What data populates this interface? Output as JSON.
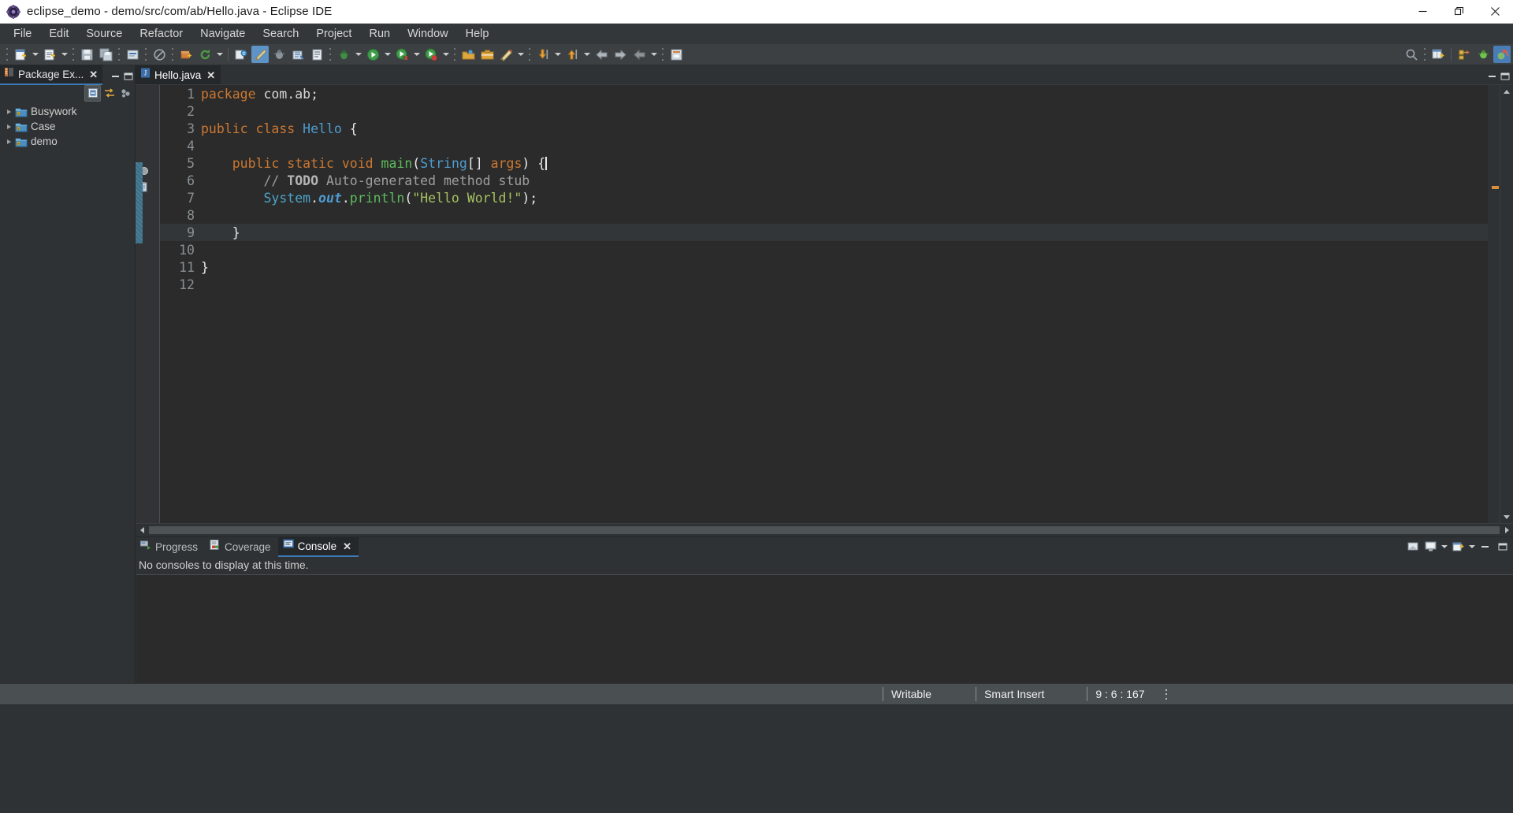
{
  "window": {
    "title": "eclipse_demo - demo/src/com/ab/Hello.java - Eclipse IDE",
    "app_icon": "eclipse-icon",
    "controls": {
      "minimize": "minimize-icon",
      "restore": "restore-icon",
      "close": "close-icon"
    }
  },
  "menubar": {
    "items": [
      {
        "label": "File"
      },
      {
        "label": "Edit"
      },
      {
        "label": "Source"
      },
      {
        "label": "Refactor"
      },
      {
        "label": "Navigate"
      },
      {
        "label": "Search"
      },
      {
        "label": "Project"
      },
      {
        "label": "Run"
      },
      {
        "label": "Window"
      },
      {
        "label": "Help"
      }
    ]
  },
  "toolbar": {
    "groups": [
      {
        "items": [
          {
            "icon": "new-wizard-icon",
            "dropdown": true
          },
          {
            "icon": "new-java-project-icon",
            "dropdown": true
          }
        ]
      },
      {
        "items": [
          {
            "icon": "save-icon",
            "dropdown": false
          },
          {
            "icon": "save-all-icon",
            "dropdown": false
          }
        ]
      },
      {
        "items": [
          {
            "icon": "print-icon",
            "dropdown": false
          }
        ]
      },
      {
        "items": [
          {
            "icon": "no-entry-icon",
            "dropdown": false
          }
        ]
      },
      {
        "items": [
          {
            "icon": "new-package-icon",
            "dropdown": false
          },
          {
            "icon": "refresh-icon",
            "dropdown": true
          }
        ]
      },
      {
        "items": [
          {
            "icon": "open-type-icon",
            "dropdown": false
          },
          {
            "icon": "search-ruler-icon",
            "dropdown": false
          },
          {
            "icon": "debug-bug-icon",
            "dropdown": false
          },
          {
            "icon": "external-tools-icon",
            "dropdown": false
          },
          {
            "icon": "open-task-icon",
            "dropdown": false
          }
        ]
      },
      {
        "items": [
          {
            "icon": "debug-icon",
            "dropdown": true
          }
        ]
      },
      {
        "items": [
          {
            "icon": "run-icon",
            "dropdown": true
          },
          {
            "icon": "coverage-icon",
            "dropdown": true
          },
          {
            "icon": "run-record-icon",
            "dropdown": true
          }
        ]
      },
      {
        "items": [
          {
            "icon": "open-folder-icon",
            "dropdown": false
          },
          {
            "icon": "briefcase-icon",
            "dropdown": false
          },
          {
            "icon": "pencil-icon",
            "dropdown": true
          }
        ]
      },
      {
        "items": [
          {
            "icon": "step-into-icon",
            "dropdown": true
          },
          {
            "icon": "step-return-icon",
            "dropdown": true
          }
        ]
      },
      {
        "items": [
          {
            "icon": "back-arrow-icon",
            "dropdown": false
          },
          {
            "icon": "forward-arrow-icon",
            "dropdown": false
          },
          {
            "icon": "previous-arrow-icon",
            "dropdown": false
          },
          {
            "icon": "next-arrow-icon",
            "dropdown": false
          }
        ]
      },
      {
        "items": [
          {
            "icon": "pin-editor-icon",
            "dropdown": false
          }
        ]
      }
    ],
    "right": [
      {
        "icon": "quick-search-icon"
      },
      {
        "icon": "new-window-icon"
      },
      {
        "icon": "java-perspective-icon"
      },
      {
        "icon": "debug-perspective-icon"
      },
      {
        "icon": "java-ee-perspective-icon"
      }
    ]
  },
  "package_explorer": {
    "tab_label": "Package Ex...",
    "tab_icon": "package-explorer-icon",
    "close_icon": "close-icon",
    "minimize_icon": "minimize-icon",
    "maximize_icon": "maximize-icon",
    "view_toolbar": [
      {
        "icon": "collapse-all-icon",
        "selected": true
      },
      {
        "icon": "link-with-editor-icon",
        "selected": false
      },
      {
        "icon": "view-menu-icon",
        "selected": false
      }
    ],
    "tree": [
      {
        "label": "Busywork",
        "icon": "java-project-icon",
        "expanded": false
      },
      {
        "label": "Case",
        "icon": "java-project-icon",
        "expanded": false
      },
      {
        "label": "demo",
        "icon": "java-project-icon",
        "expanded": false
      }
    ]
  },
  "editor": {
    "tab": {
      "label": "Hello.java",
      "icon": "java-file-icon",
      "close_icon": "close-icon"
    },
    "minimize_icon": "minimize-icon",
    "maximize_icon": "maximize-icon",
    "lines": [
      {
        "n": "1",
        "tokens": [
          {
            "t": "package",
            "c": "kw"
          },
          {
            "t": " com.ab;",
            "c": "ctext"
          }
        ]
      },
      {
        "n": "2",
        "tokens": []
      },
      {
        "n": "3",
        "tokens": [
          {
            "t": "public",
            "c": "kw"
          },
          {
            "t": " ",
            "c": "ctext"
          },
          {
            "t": "class",
            "c": "kw"
          },
          {
            "t": " ",
            "c": "ctext"
          },
          {
            "t": "Hello",
            "c": "cls"
          },
          {
            "t": " {",
            "c": "punct"
          }
        ]
      },
      {
        "n": "4",
        "tokens": []
      },
      {
        "n": "5",
        "tokens": [
          {
            "t": "    ",
            "c": "ctext"
          },
          {
            "t": "public",
            "c": "kw"
          },
          {
            "t": " ",
            "c": "ctext"
          },
          {
            "t": "static",
            "c": "kw"
          },
          {
            "t": " ",
            "c": "ctext"
          },
          {
            "t": "void",
            "c": "kw"
          },
          {
            "t": " ",
            "c": "ctext"
          },
          {
            "t": "main",
            "c": "mth"
          },
          {
            "t": "(",
            "c": "punct"
          },
          {
            "t": "String",
            "c": "cls"
          },
          {
            "t": "[] ",
            "c": "punct"
          },
          {
            "t": "args",
            "c": "kw"
          },
          {
            "t": ") {",
            "c": "punct"
          }
        ]
      },
      {
        "n": "6",
        "tokens": [
          {
            "t": "        // ",
            "c": "cmt"
          },
          {
            "t": "TODO",
            "c": "cmtb"
          },
          {
            "t": " Auto-generated method stub",
            "c": "cmt"
          }
        ]
      },
      {
        "n": "7",
        "tokens": [
          {
            "t": "        ",
            "c": "ctext"
          },
          {
            "t": "System",
            "c": "fld"
          },
          {
            "t": ".",
            "c": "punct"
          },
          {
            "t": "out",
            "c": "fldi"
          },
          {
            "t": ".",
            "c": "punct"
          },
          {
            "t": "println",
            "c": "mth"
          },
          {
            "t": "(",
            "c": "punct"
          },
          {
            "t": "\"Hello World!\"",
            "c": "str"
          },
          {
            "t": ");",
            "c": "punct"
          }
        ]
      },
      {
        "n": "8",
        "tokens": []
      },
      {
        "n": "9",
        "tokens": [
          {
            "t": "    }",
            "c": "punct"
          }
        ],
        "highlight": true
      },
      {
        "n": "10",
        "tokens": []
      },
      {
        "n": "11",
        "tokens": [
          {
            "t": "}",
            "c": "punct"
          }
        ]
      },
      {
        "n": "12",
        "tokens": []
      }
    ],
    "markers": {
      "breakpoint_line": 5,
      "todo_marker_line": 6,
      "folding_range": [
        5,
        9
      ]
    },
    "scroll": {
      "vertical_up_icon": "scroll-up-icon",
      "vertical_down_icon": "scroll-down-icon",
      "horizontal_left_icon": "scroll-left-icon",
      "horizontal_right_icon": "scroll-right-icon"
    }
  },
  "console_panel": {
    "tabs": [
      {
        "label": "Progress",
        "icon": "progress-icon",
        "active": false,
        "closable": false
      },
      {
        "label": "Coverage",
        "icon": "coverage-icon",
        "active": false,
        "closable": false
      },
      {
        "label": "Console",
        "icon": "console-icon",
        "active": true,
        "closable": true
      }
    ],
    "close_icon": "close-icon",
    "message": "No consoles to display at this time.",
    "toolbar": [
      {
        "icon": "open-console-icon"
      },
      {
        "icon": "display-selected-console-icon"
      },
      {
        "icon": "console-dropdown-icon"
      },
      {
        "icon": "new-console-view-icon"
      },
      {
        "icon": "view-menu-arrow-icon"
      }
    ],
    "minimize_icon": "minimize-icon",
    "maximize_icon": "maximize-icon"
  },
  "statusbar": {
    "writable": "Writable",
    "insert_mode": "Smart Insert",
    "position": "9 : 6 : 167",
    "menu_icon": "status-menu-icon"
  },
  "colors": {
    "titlebar_bg": "#ffffff",
    "menubar_bg": "#33373a",
    "toolbar_bg": "#3c4043",
    "panel_bg": "#2f3234",
    "editor_bg": "#2b2b2b",
    "tab_active_bg": "#25282a",
    "tab_accent": "#3d7ab5",
    "statusbar_bg": "#4a4f52",
    "keyword": "#cc7832",
    "class_name": "#4e9cd1",
    "method_name": "#5dba5d",
    "string": "#a5c261",
    "comment": "#9e9e9e",
    "field": "#4ba5c9"
  }
}
